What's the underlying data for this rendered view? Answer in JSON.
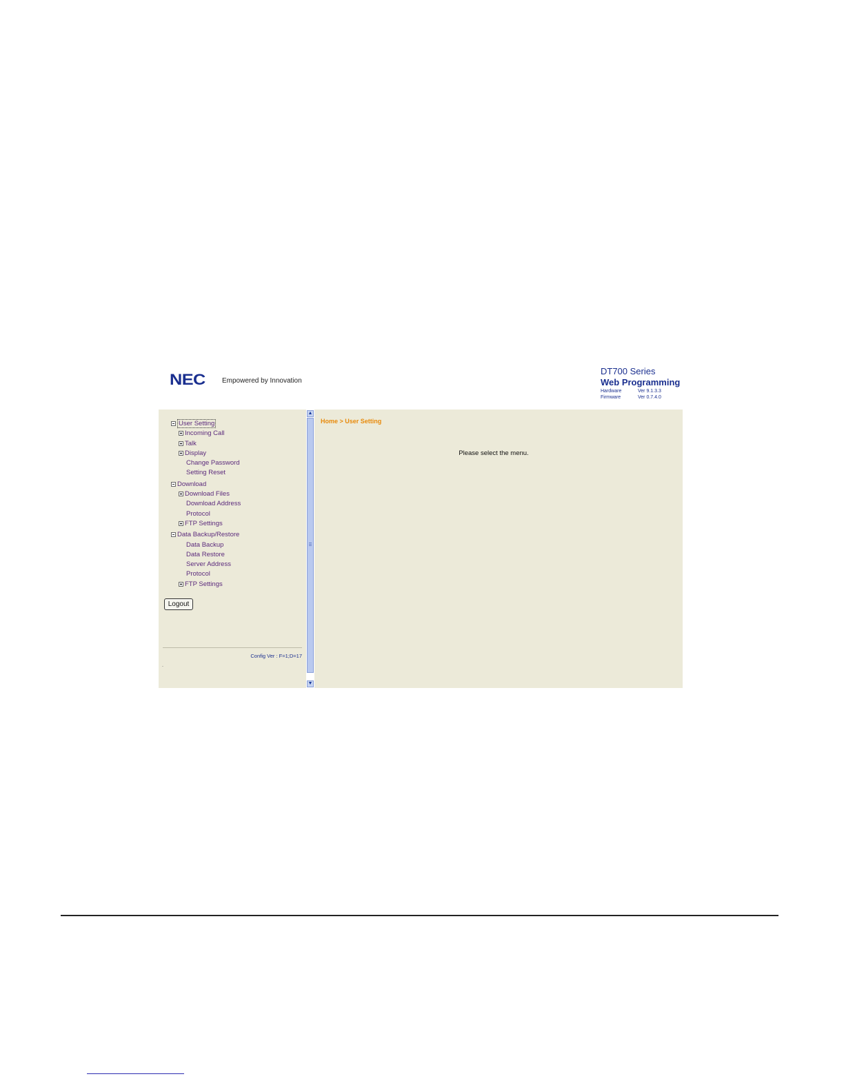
{
  "header": {
    "logo_text": "NEC",
    "tagline": "Empowered by Innovation",
    "product_line1": "DT700 Series",
    "product_line2": "Web Programming",
    "versions": [
      {
        "label": "Hardware",
        "value": "Ver 9.1.3.3"
      },
      {
        "label": "Firmware",
        "value": "Ver 0.7.4.0"
      }
    ]
  },
  "menu": [
    {
      "label": "User Setting",
      "level": 0,
      "toggle": "minus",
      "selected": true
    },
    {
      "label": "Incoming Call",
      "level": 1,
      "toggle": "plus"
    },
    {
      "label": "Talk",
      "level": 1,
      "toggle": "plus"
    },
    {
      "label": "Display",
      "level": 1,
      "toggle": "plus"
    },
    {
      "label": "Change Password",
      "level": 1,
      "toggle": "none"
    },
    {
      "label": "Setting Reset",
      "level": 1,
      "toggle": "none"
    },
    {
      "label": "Download",
      "level": 0,
      "toggle": "minus"
    },
    {
      "label": "Download Files",
      "level": 1,
      "toggle": "plus"
    },
    {
      "label": "Download Address",
      "level": 1,
      "toggle": "none"
    },
    {
      "label": "Protocol",
      "level": 1,
      "toggle": "none"
    },
    {
      "label": "FTP Settings",
      "level": 1,
      "toggle": "plus"
    },
    {
      "label": "Data Backup/Restore",
      "level": 0,
      "toggle": "minus"
    },
    {
      "label": "Data Backup",
      "level": 1,
      "toggle": "none"
    },
    {
      "label": "Data Restore",
      "level": 1,
      "toggle": "none"
    },
    {
      "label": "Server Address",
      "level": 1,
      "toggle": "none"
    },
    {
      "label": "Protocol",
      "level": 1,
      "toggle": "none"
    },
    {
      "label": "FTP Settings",
      "level": 1,
      "toggle": "plus"
    }
  ],
  "sidebar": {
    "logout_label": "Logout",
    "config_version": "Config Ver : F=1;D=17",
    "footer_dot": "."
  },
  "main": {
    "breadcrumb": "Home > User Setting",
    "message": "Please select the menu."
  },
  "icons": {
    "expand": "plus-icon",
    "collapse": "minus-icon",
    "scroll_up": "chevron-up-icon",
    "scroll_down": "chevron-down-icon"
  },
  "colors": {
    "brand_blue": "#1a2f8f",
    "panel_bg": "#ecead9",
    "menu_link": "#5b2a7c",
    "breadcrumb": "#e88a0b"
  }
}
